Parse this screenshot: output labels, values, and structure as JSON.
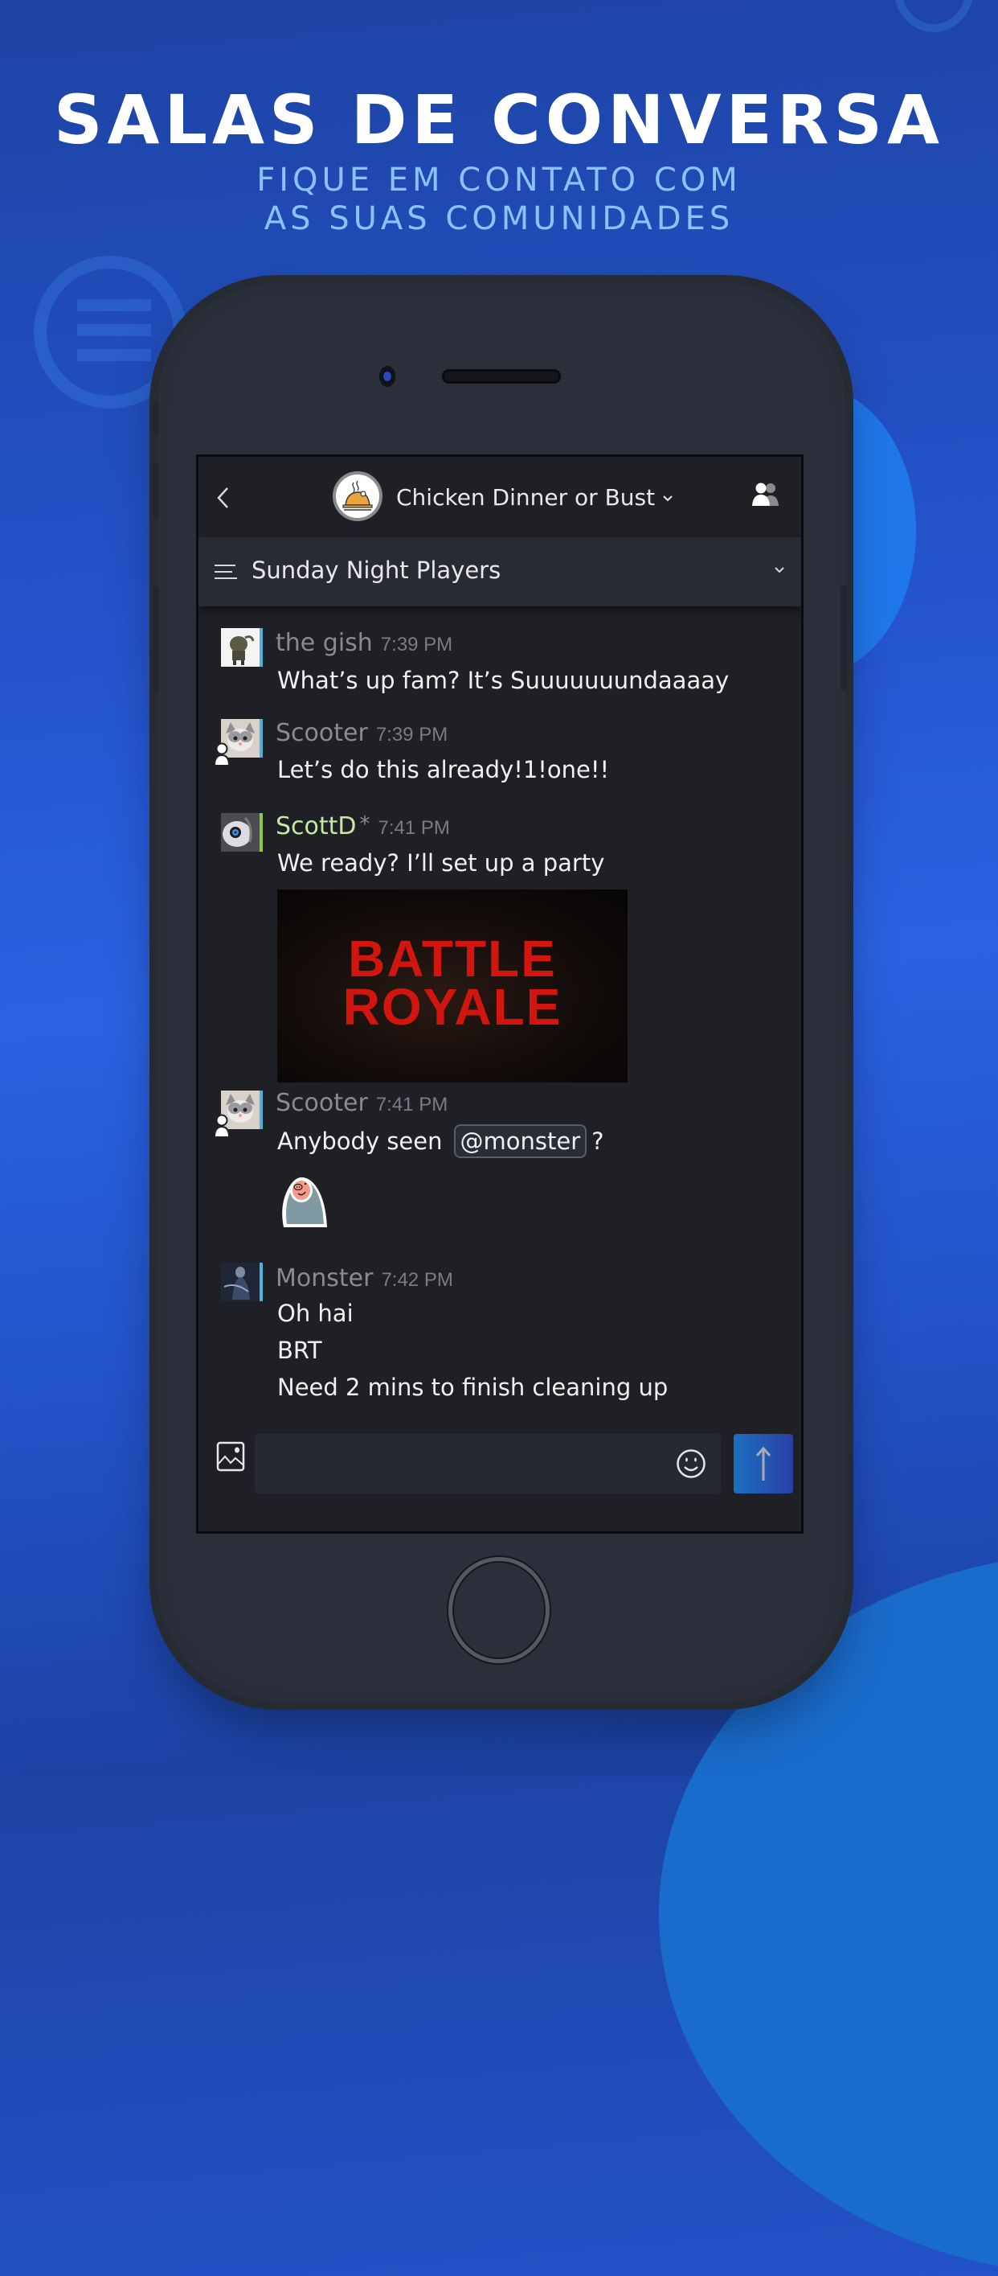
{
  "promo": {
    "headline": "SALAS DE CONVERSA",
    "subline_1": "FIQUE EM CONTATO COM",
    "subline_2": "AS SUAS COMUNIDADES"
  },
  "header": {
    "back_icon": "chevron-left-icon",
    "group_avatar": "roast-chicken-icon",
    "group_name": "Chicken Dinner or Bust",
    "group_dropdown_icon": "chevron-down-icon",
    "members_icon": "friends-icon"
  },
  "channel": {
    "menu_icon": "channel-list-icon",
    "name": "Sunday Night Players",
    "dropdown_icon": "chevron-down-icon"
  },
  "messages": [
    {
      "sender": "the gish",
      "time": "7:39 PM",
      "status": "online",
      "mobile": false,
      "lines": [
        "What’s up fam? It’s Suuuuuuundaaaay"
      ]
    },
    {
      "sender": "Scooter",
      "time": "7:39 PM",
      "status": "online",
      "mobile": true,
      "lines": [
        "Let’s do this already!1!one!!"
      ]
    },
    {
      "sender": "ScottD",
      "sender_marker": "*",
      "time": "7:41 PM",
      "status": "in-game",
      "mobile": false,
      "lines": [
        "We ready? I’ll set up a party"
      ],
      "image": {
        "line1": "BATTLE",
        "line2": "ROYALE"
      }
    },
    {
      "sender": "Scooter",
      "time": "7:41 PM",
      "status": "online",
      "mobile": true,
      "text_before": "Anybody seen",
      "mention": "@monster",
      "text_after": "?",
      "sticker": "pig-in-blanket-sticker"
    },
    {
      "sender": "Monster",
      "time": "7:42 PM",
      "status": "online",
      "mobile": false,
      "lines": [
        "Oh hai",
        "BRT",
        "Need 2 mins to finish cleaning up"
      ]
    }
  ],
  "composer": {
    "image_icon": "image-upload-icon",
    "input_value": "",
    "emoji_icon": "emoji-smiley-icon",
    "send_icon": "arrow-up-icon"
  },
  "colors": {
    "background_blue": "#2454cc",
    "screen_bg": "#1f2026",
    "channel_bar": "#282b33",
    "online_stripe": "#4fb1dc",
    "ingame_stripe": "#8fc83c",
    "ingame_name": "#c6e8a2",
    "send_button": "#1b6fbf"
  }
}
